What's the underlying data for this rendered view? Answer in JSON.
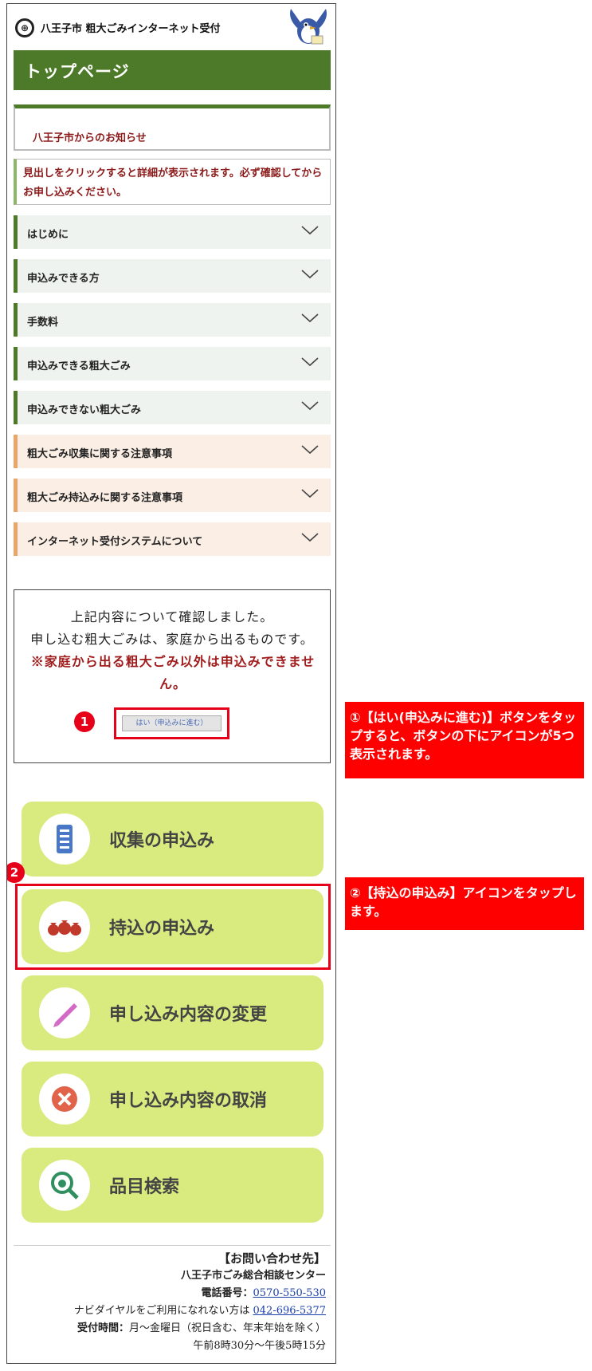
{
  "header": {
    "site_title": "八王子市 粗大ごみインターネット受付",
    "logo_glyph": "⊕"
  },
  "page_title": "トップページ",
  "notice": {
    "title": "八王子市からのお知らせ"
  },
  "instruction": "見出しをクリックすると詳細が表示されます。必ず確認してからお申し込みください。",
  "accordion": [
    {
      "label": "はじめに",
      "style": "green"
    },
    {
      "label": "申込みできる方",
      "style": "green"
    },
    {
      "label": "手数料",
      "style": "green"
    },
    {
      "label": "申込みできる粗大ごみ",
      "style": "green"
    },
    {
      "label": "申込みできない粗大ごみ",
      "style": "green"
    },
    {
      "label": "粗大ごみ収集に関する注意事項",
      "style": "orange"
    },
    {
      "label": "粗大ごみ持込みに関する注意事項",
      "style": "orange"
    },
    {
      "label": "インターネット受付システムについて",
      "style": "orange"
    }
  ],
  "confirm": {
    "line1": "上記内容について確認しました。",
    "line2": "申し込む粗大ごみは、家庭から出るものです。",
    "warning": "※家庭から出る粗大ごみ以外は申込みできません。",
    "yes_button": "はい（申込みに進む）"
  },
  "tiles": [
    {
      "label": "収集の申込み",
      "icon": "document-stack-icon"
    },
    {
      "label": "持込の申込み",
      "icon": "money-bags-icon"
    },
    {
      "label": "申し込み内容の変更",
      "icon": "pencil-icon"
    },
    {
      "label": "申し込み内容の取消",
      "icon": "cancel-x-icon"
    },
    {
      "label": "品目検索",
      "icon": "magnifier-icon"
    }
  ],
  "footer": {
    "heading": "【お問い合わせ先】",
    "center": "八王子市ごみ総合相談センター",
    "phone_label": "電話番号：",
    "phone": "0570-550-530",
    "alt_label": "ナビダイヤルをご利用になれない方は ",
    "alt_phone": "042-696-5377",
    "hours_label": "受付時間：",
    "hours": "月～金曜日（祝日含む、年末年始を除く）",
    "hours2": "午前8時30分～午後5時15分"
  },
  "annotations": {
    "badge1": "1",
    "badge2": "2",
    "callout1": "①【はい(申込みに進む)】ボタンをタップすると、ボタンの下にアイコンが5つ表示されます。",
    "callout2": "②【持込の申込み】アイコンをタップします。"
  },
  "colors": {
    "title_green": "#4d7a28",
    "notice_red": "#8b1a1a",
    "tile_green": "#d9ea7e",
    "annotation_red": "#e6001a"
  }
}
